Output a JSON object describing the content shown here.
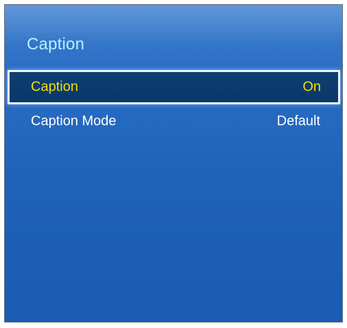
{
  "header": {
    "title": "Caption"
  },
  "menu": {
    "items": [
      {
        "label": "Caption",
        "value": "On",
        "selected": true
      },
      {
        "label": "Caption Mode",
        "value": "Default",
        "selected": false
      }
    ]
  },
  "colors": {
    "panel_background": "#1f62ba",
    "title_text": "#b9f0ff",
    "selected_text": "#f2e000",
    "selected_background": "#0d3f74",
    "normal_text": "#ffffff"
  }
}
